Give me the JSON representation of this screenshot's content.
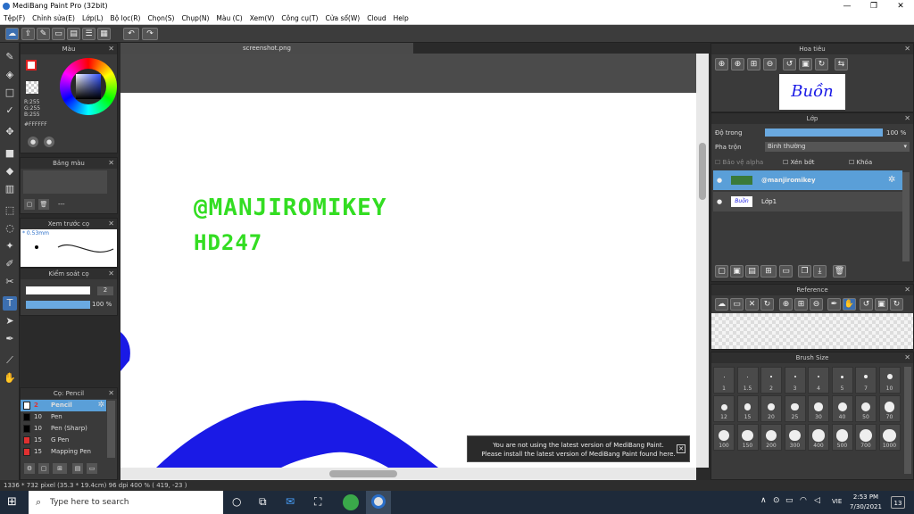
{
  "app": {
    "title": "MediBang Paint Pro (32bit)"
  },
  "window_controls": {
    "minimize": "—",
    "maximize": "❐",
    "close": "✕"
  },
  "menu": [
    "Tệp(F)",
    "Chỉnh sửa(E)",
    "Lớp(L)",
    "Bộ lọc(R)",
    "Chọn(S)",
    "Chụp(N)",
    "Màu (C)",
    "Xem(V)",
    "Công cụ(T)",
    "Cửa sổ(W)",
    "Cloud",
    "Help"
  ],
  "canvas": {
    "tab_title": "screenshot.png",
    "text_line1": "@MANJIROMIKEY",
    "text_line2": "HD247",
    "shape_color": "#1a1ae6",
    "text_color": "#33dd22"
  },
  "color_panel": {
    "title": "Màu",
    "r": "R:255",
    "g": "G:255",
    "b": "B:255",
    "hex": "#FFFFFF"
  },
  "palette_panel": {
    "title": "Bảng màu",
    "dash": "---"
  },
  "preview_panel": {
    "title": "Xem trước cọ",
    "size": "* 0.53mm"
  },
  "brush_control": {
    "title": "Kiểm soát cọ",
    "size_value": "2",
    "opacity_value": "100 %"
  },
  "brush_list": {
    "title": "Cọ: Pencil",
    "items": [
      {
        "size": "2",
        "name": "Pencil",
        "color": "#ffffff",
        "selected": true
      },
      {
        "size": "10",
        "name": "Pen",
        "color": "#000000"
      },
      {
        "size": "10",
        "name": "Pen (Sharp)",
        "color": "#000000"
      },
      {
        "size": "15",
        "name": "G Pen",
        "color": "#e03030"
      },
      {
        "size": "15",
        "name": "Mapping Pen",
        "color": "#e03030"
      }
    ]
  },
  "navigator": {
    "title": "Hoa tiêu",
    "thumb_text": "Buồn"
  },
  "layer_panel": {
    "title": "Lớp",
    "opacity_label": "Độ trong",
    "opacity_value": "100 %",
    "blend_label": "Pha trộn",
    "blend_value": "Bình thường",
    "protect_alpha": "Bảo vệ alpha",
    "clipping": "Xén bớt",
    "lock": "Khóa",
    "layers": [
      {
        "name": "@manjiromikey",
        "selected": true
      },
      {
        "name": "Lớp1",
        "selected": false
      }
    ]
  },
  "reference_panel": {
    "title": "Reference"
  },
  "brush_size_panel": {
    "title": "Brush Size",
    "sizes": [
      "1",
      "1.5",
      "2",
      "3",
      "4",
      "5",
      "7",
      "10",
      "12",
      "15",
      "20",
      "25",
      "30",
      "40",
      "50",
      "70",
      "100",
      "150",
      "200",
      "300",
      "400",
      "500",
      "700",
      "1000"
    ]
  },
  "notification": {
    "line1": "You are not using the latest version of MediBang Paint.",
    "line2": "Please install the latest version of MediBang Paint found here.",
    "close": "✕"
  },
  "status": {
    "text": "1336 * 732 pixel  (35.3 * 19.4cm)  96 dpi  400 %  ( 419, -23 )"
  },
  "taskbar": {
    "search_placeholder": "Type here to search",
    "language": "VIE",
    "time": "2:53 PM",
    "date": "7/30/2021",
    "notif_count": "13"
  }
}
